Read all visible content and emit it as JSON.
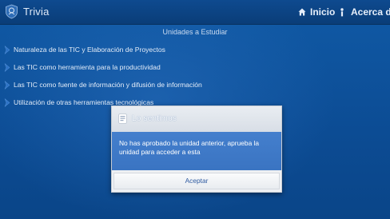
{
  "app": {
    "title": "Trivia",
    "icon": "app-logo-icon"
  },
  "menu": {
    "inicio": {
      "label": "Inicio",
      "icon": "home-icon"
    },
    "acerca": {
      "label": "Acerca de",
      "icon": "info-icon"
    }
  },
  "section": {
    "header": "Unidades a Estudiar"
  },
  "units": [
    {
      "label": "Naturaleza de las TIC y Elaboración de Proyectos",
      "icon": "chevron-right-icon"
    },
    {
      "label": "Las TIC como herramienta para la productividad",
      "icon": "chevron-right-icon"
    },
    {
      "label": "Las TIC como fuente de información y difusión de información",
      "icon": "chevron-right-icon"
    },
    {
      "label": "Utilización de otras herramientas tecnológicas",
      "icon": "chevron-right-icon"
    }
  ],
  "dialog": {
    "title": "Lo sentimos",
    "message": "No has aprobado la unidad anterior, aprueba la unidad para acceder a esta",
    "accept_label": "Aceptar",
    "icon": "dialog-app-icon"
  },
  "colors": {
    "background": "#0d4f98",
    "actionbar": "#0b3f7c",
    "dialog_body": "#3e79c8",
    "accept_text": "#2e5aa0"
  }
}
